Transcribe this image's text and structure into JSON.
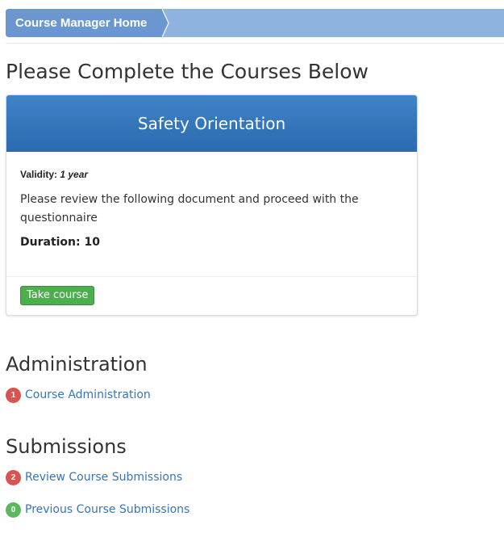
{
  "breadcrumb": {
    "home_label": "Course Manager Home"
  },
  "page": {
    "title": "Please Complete the Courses Below"
  },
  "course": {
    "title": "Safety Orientation",
    "validity_label": "Validity:",
    "validity_value": "1 year",
    "description": "Please review the following document and proceed with the questionnaire",
    "duration": "Duration: 10",
    "take_button": "Take course"
  },
  "administration": {
    "heading": "Administration",
    "items": [
      {
        "label": "Course Administration",
        "badge": "1",
        "badge_color": "#d9534f"
      }
    ]
  },
  "submissions": {
    "heading": "Submissions",
    "items": [
      {
        "label": "Review Course Submissions",
        "badge": "2",
        "badge_color": "#d9534f"
      },
      {
        "label": "Previous Course Submissions",
        "badge": "0",
        "badge_color": "#5cb85c"
      }
    ]
  },
  "colors": {
    "breadcrumb_bg": "#8fb3df",
    "breadcrumb_active": "#6b97d0",
    "card_header": "#3377bd",
    "link": "#3a74b5",
    "success": "#4cae4c",
    "danger": "#d9534f"
  }
}
